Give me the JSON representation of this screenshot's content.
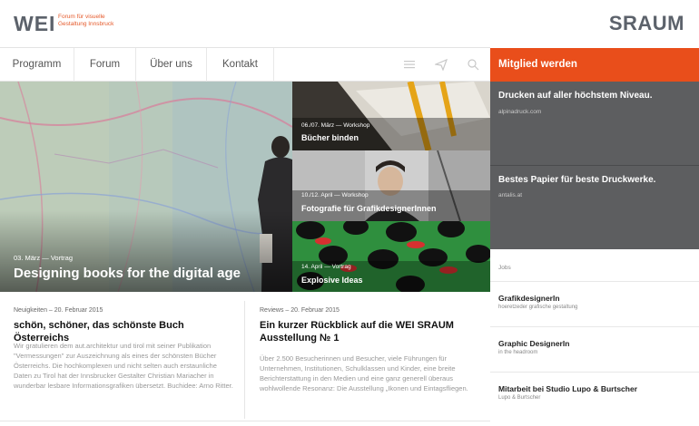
{
  "brand": {
    "logo": "WEI",
    "tagline": "Forum für visuelle Gestaltung Innsbruck",
    "logo_right": "SRAUM"
  },
  "nav": {
    "items": [
      "Programm",
      "Forum",
      "Über uns",
      "Kontakt"
    ],
    "icons": [
      "menu-icon",
      "send-icon",
      "search-icon"
    ]
  },
  "member_button": "Mitglied werden",
  "hero": {
    "meta": "03. März — Vortrag",
    "title": "Designing books for the digital age"
  },
  "tiles": [
    {
      "meta": "06./07. März — Workshop",
      "title": "Bücher binden"
    },
    {
      "meta": "10./12. April — Workshop",
      "title": "Fotografie für GrafikdesignerInnen"
    },
    {
      "meta": "14. April — Vortrag",
      "title": "Explosive Ideas"
    }
  ],
  "ads": [
    {
      "title": "Drucken auf aller höchstem Niveau.",
      "sub": "alpinadruck.com"
    },
    {
      "title": "Bestes Papier für beste Druckwerke.",
      "sub": "antalis.at"
    }
  ],
  "jobs": {
    "label": "Jobs",
    "items": [
      {
        "title": "GrafikdesignerIn",
        "sub": "hoeretzeder grafische gestaltung"
      },
      {
        "title": "Graphic DesignerIn",
        "sub": "in the headroom"
      },
      {
        "title": "Mitarbeit bei Studio Lupo & Burtscher",
        "sub": "Lupo & Burtscher"
      }
    ]
  },
  "articles": [
    {
      "meta": "Neuigkeiten – 20. Februar 2015",
      "title": "schön, schöner, das schönste Buch Österreichs",
      "body": "Wir gratulieren dem aut.architektur und tirol mit seiner Publikation \"Vermessungen\" zur Auszeichnung als eines der schönsten Bücher Österreichs. Die hochkomplexen und nicht selten auch erstaunliche Daten zu Tirol hat der Innsbrucker Gestalter Christian Mariacher in wunderbar lesbare Informationsgrafiken übersetzt. Buchidee: Arno Ritter."
    },
    {
      "meta": "Reviews – 20. Februar 2015",
      "title": "Ein kurzer Rückblick auf die WEI SRAUM Ausstellung № 1",
      "body": "Über 2.500 Besucherinnen und Besucher, viele Führungen für Unternehmen, Institutionen, Schulklassen und Kinder, eine breite Berichterstattung in den Medien und eine ganz generell überaus wohlwollende Resonanz: Die Ausstellung „Ikonen und Eintagsfliegen."
    }
  ],
  "colors": {
    "accent": "#e94e1b",
    "ad_bg": "#5d5e60",
    "logo": "#5c626b"
  }
}
